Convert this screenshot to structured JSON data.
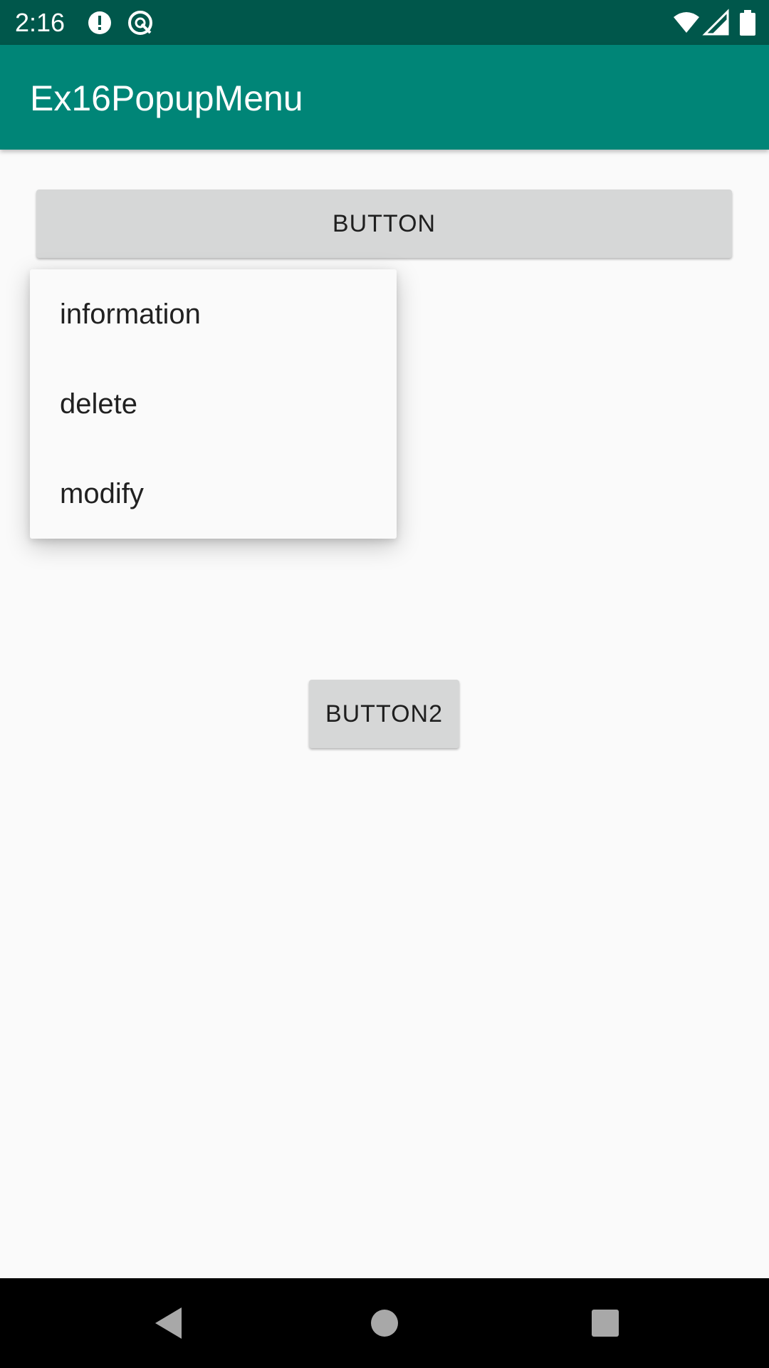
{
  "status_bar": {
    "time": "2:16",
    "icons": [
      "alert-icon",
      "data-saver-icon",
      "wifi-icon",
      "signal-icon",
      "battery-icon"
    ],
    "background": "#00574b"
  },
  "app_bar": {
    "title": "Ex16PopupMenu",
    "background": "#008577"
  },
  "main": {
    "button1_label": "BUTTON",
    "button2_label": "BUTTON2"
  },
  "popup_menu": {
    "items": [
      {
        "label": "information"
      },
      {
        "label": "delete"
      },
      {
        "label": "modify"
      }
    ]
  },
  "nav_bar": {
    "buttons": [
      "back-icon",
      "home-icon",
      "recents-icon"
    ]
  }
}
